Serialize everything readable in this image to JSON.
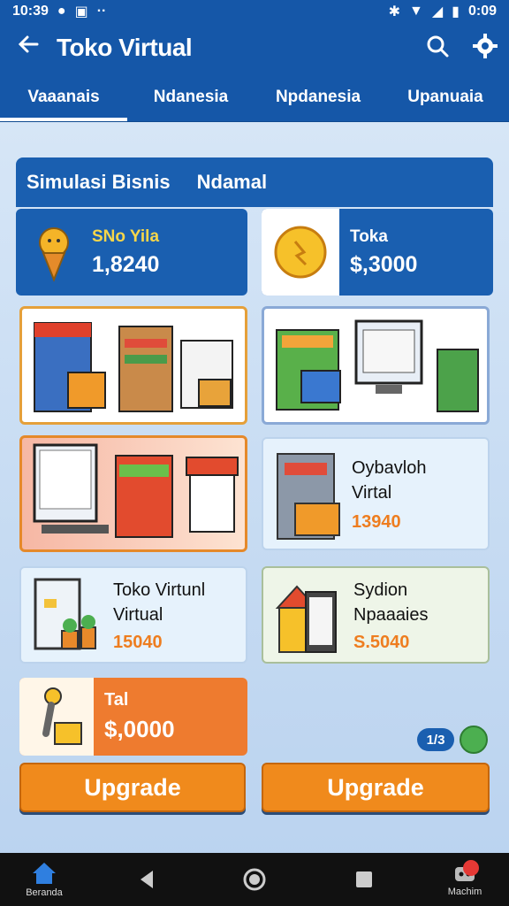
{
  "statusbar": {
    "time_left": "10:39",
    "time_right": "0:09"
  },
  "appbar": {
    "title": "Toko Virtual"
  },
  "tabs": [
    "Vaaanais",
    "Ndanesia",
    "Npdanesia",
    "Upanuaia"
  ],
  "header": {
    "left": "Simulasi Bisnis",
    "right": "Ndamal"
  },
  "stats": [
    {
      "label": "SNo Yila",
      "value": "1,8240"
    },
    {
      "label": "Toka",
      "value": "$,3000"
    }
  ],
  "info_cards": [
    {
      "line1": "Oybavloh",
      "line2": "Virtal",
      "price": "13940"
    },
    {
      "line1": "Toko Virtunl",
      "line2": "Virtual",
      "price": "15040"
    },
    {
      "line1": "Sydion",
      "line2": "Npaaaies",
      "price": "S.5040"
    }
  ],
  "orange_card": {
    "label": "Tal",
    "value": "$,0000"
  },
  "buttons": [
    "Upgrade",
    "Upgrade"
  ],
  "page_indicator": "1/3",
  "nav": {
    "home": "Beranda",
    "machine": "Machim"
  },
  "colors": {
    "primary": "#1557a8",
    "accent": "#f08a1c"
  }
}
